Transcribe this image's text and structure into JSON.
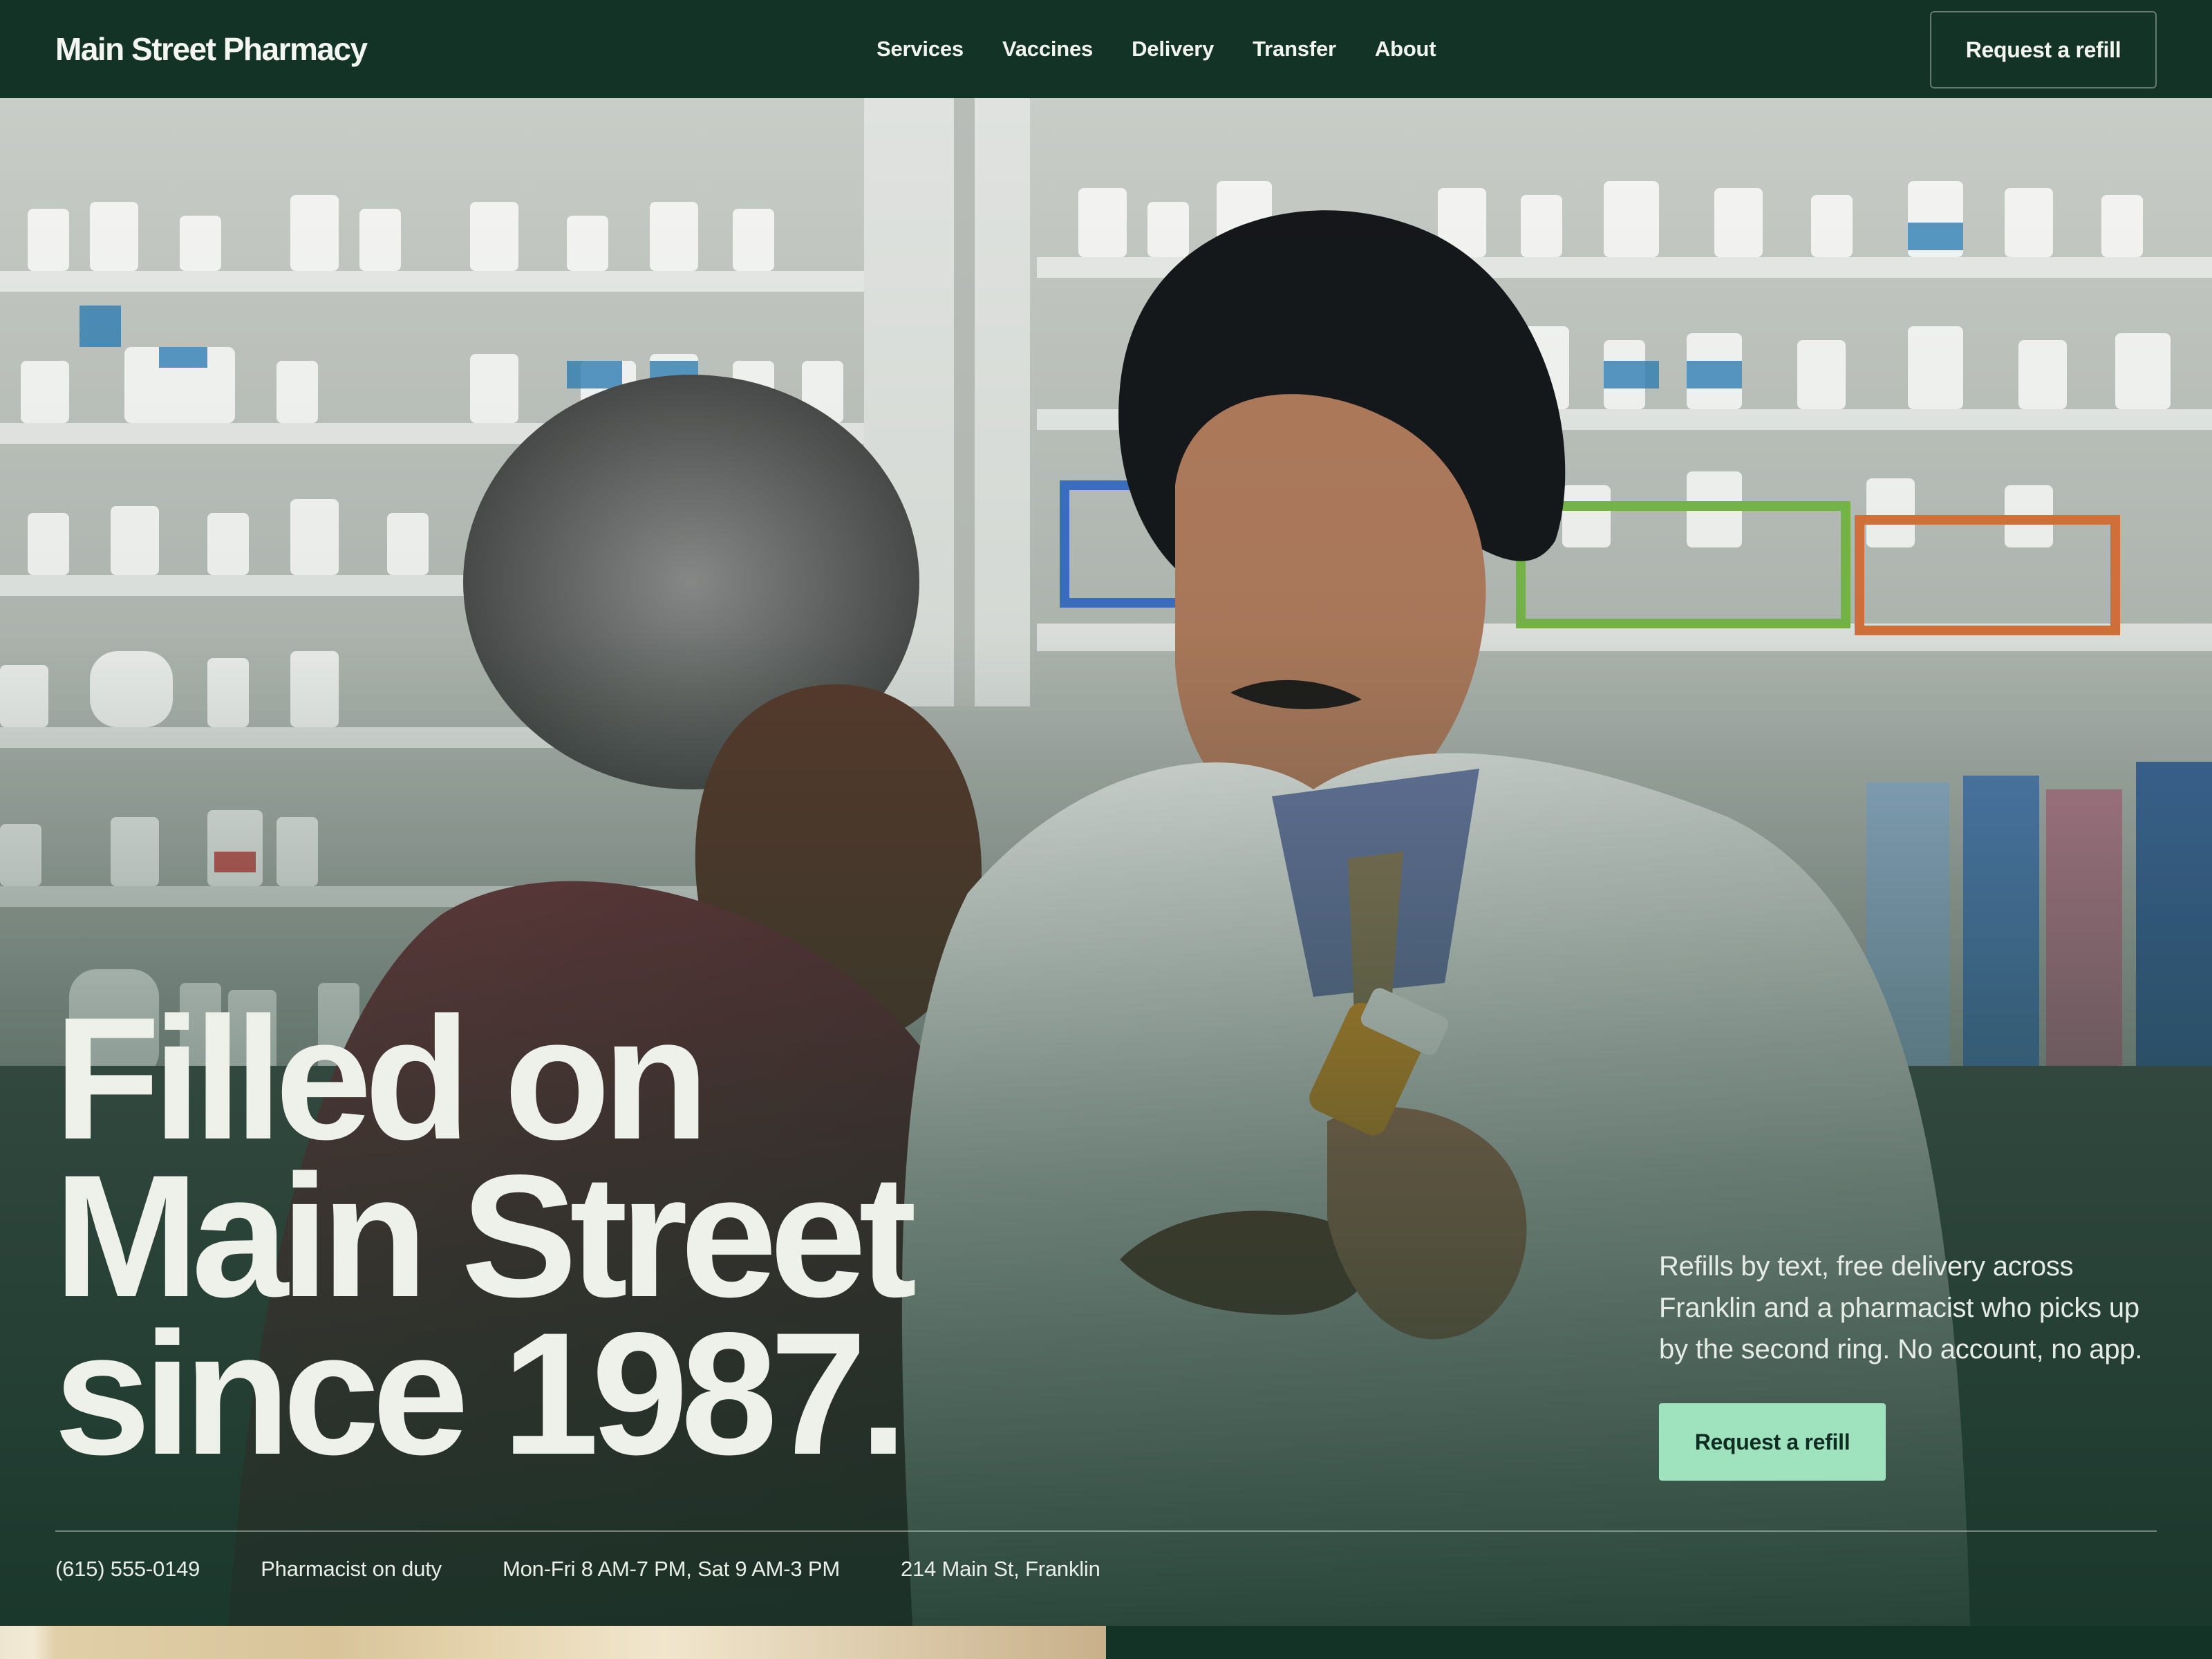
{
  "header": {
    "brand": "Main Street Pharmacy",
    "nav": [
      "Services",
      "Vaccines",
      "Delivery",
      "Transfer",
      "About"
    ],
    "cta_label": "Request a refill"
  },
  "hero": {
    "headline": [
      "Filled on",
      "Main Street",
      "since 1987."
    ],
    "copy": "Refills by text, free delivery across Franklin and a pharmacist who picks up by the second ring. No account, no app.",
    "cta_label": "Request a refill"
  },
  "info_bar": {
    "phone": "(615) 555-0149",
    "status": "Pharmacist on duty",
    "hours": "Mon-Fri 8 AM-7 PM, Sat 9 AM-3 PM",
    "address": "214 Main St, Franklin"
  },
  "colors": {
    "brand_dark": "#143327",
    "accent_mint": "#9fe3be",
    "text_light": "#eef1ea"
  }
}
